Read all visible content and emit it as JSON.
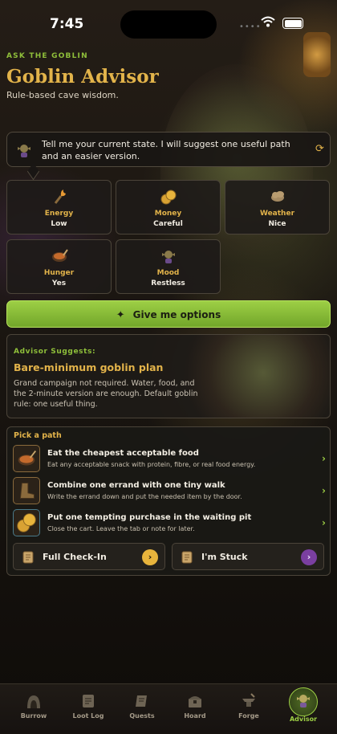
{
  "status_bar": {
    "time": "7:45",
    "dots": "••••"
  },
  "header": {
    "eyebrow": "ASK THE GOBLIN",
    "title": "Goblin Advisor",
    "subtitle": "Rule-based cave wisdom."
  },
  "prompt": {
    "message": "Tell me your current state. I will suggest one useful path and an easier version.",
    "icon": "goblin-icon",
    "refresh_icon": "refresh-icon"
  },
  "states": [
    {
      "label": "Energy",
      "value": "Low",
      "icon": "torch-icon"
    },
    {
      "label": "Money",
      "value": "Careful",
      "icon": "coins-icon"
    },
    {
      "label": "Weather",
      "value": "Nice",
      "icon": "cloud-icon"
    },
    {
      "label": "Hunger",
      "value": "Yes",
      "icon": "stew-icon"
    },
    {
      "label": "Mood",
      "value": "Restless",
      "icon": "goblin-mood-icon"
    }
  ],
  "cta": {
    "label": "Give me options"
  },
  "advice": {
    "heading": "Advisor Suggests:",
    "plan": "Bare-minimum goblin plan",
    "description": "Grand campaign not required. Water, food, and the 2-minute version are enough. Default goblin rule: one useful thing."
  },
  "paths": {
    "heading": "Pick a path",
    "items": [
      {
        "title": "Eat the cheapest acceptable food",
        "subtitle": "Eat any acceptable snack with protein, fibre, or real food energy.",
        "icon": "stew-icon"
      },
      {
        "title": "Combine one errand with one tiny walk",
        "subtitle": "Write the errand down and put the needed item by the door.",
        "icon": "boot-icon"
      },
      {
        "title": "Put one tempting purchase in the waiting pit",
        "subtitle": "Close the cart. Leave the tab or note for later.",
        "icon": "coins-icon"
      }
    ],
    "buttons": [
      {
        "label": "Full Check-In",
        "icon": "scroll-icon",
        "color": "#e8b43c"
      },
      {
        "label": "I'm Stuck",
        "icon": "scroll-icon",
        "color": "#7a3fa0"
      }
    ]
  },
  "nav": {
    "items": [
      {
        "label": "Burrow",
        "icon": "burrow-icon"
      },
      {
        "label": "Loot Log",
        "icon": "scroll-icon"
      },
      {
        "label": "Quests",
        "icon": "quest-scroll-icon"
      },
      {
        "label": "Hoard",
        "icon": "chest-icon"
      },
      {
        "label": "Forge",
        "icon": "anvil-icon"
      },
      {
        "label": "Advisor",
        "icon": "goblin-icon",
        "active": true
      }
    ]
  },
  "colors": {
    "accent_green": "#9dcf45",
    "accent_gold": "#e2b34a",
    "background": "#17130f"
  }
}
